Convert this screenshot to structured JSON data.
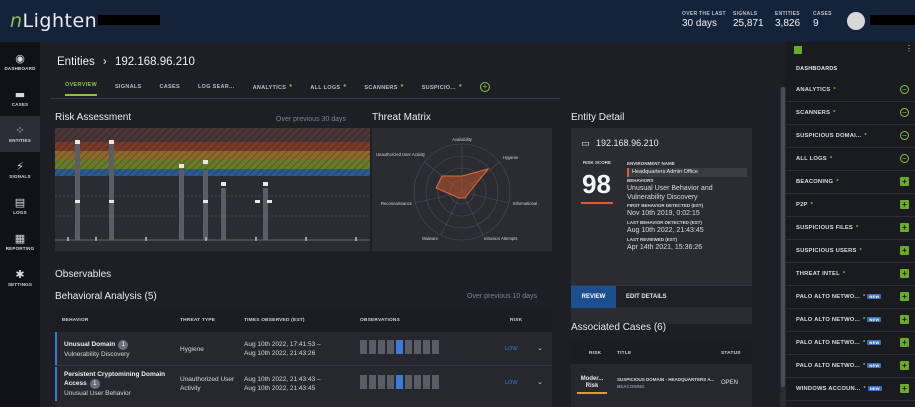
{
  "topbar": {
    "logo_prefix": "n",
    "logo_main": "Lighten",
    "stats": [
      {
        "label": "OVER THE LAST",
        "value": "30 days"
      },
      {
        "label": "SIGNALS",
        "value": "25,871"
      },
      {
        "label": "ENTITIES",
        "value": "3,826"
      },
      {
        "label": "CASES",
        "value": "9"
      }
    ]
  },
  "leftnav": [
    {
      "icon": "dashboard-icon",
      "glyph": "◉",
      "label": "DASHBOARD"
    },
    {
      "icon": "cases-icon",
      "glyph": "▬",
      "label": "CASES"
    },
    {
      "icon": "entities-icon",
      "glyph": "⁘",
      "label": "ENTITIES"
    },
    {
      "icon": "signals-icon",
      "glyph": "⚡",
      "label": "SIGNALS"
    },
    {
      "icon": "logs-icon",
      "glyph": "▤",
      "label": "LOGS"
    },
    {
      "icon": "reporting-icon",
      "glyph": "▦",
      "label": "REPORTING"
    },
    {
      "icon": "settings-icon",
      "glyph": "✱",
      "label": "SETTINGS"
    }
  ],
  "breadcrumb": {
    "parent": "Entities",
    "separator": "›",
    "current": "192.168.96.210"
  },
  "tabs": [
    "OVERVIEW",
    "SIGNALS",
    "CASES",
    "LOG SEAR...",
    "ANALYTICS",
    "ALL LOGS",
    "SCANNERS",
    "SUSPICIO..."
  ],
  "risk": {
    "title": "Risk Assessment",
    "subtitle": "Over previous 30 days"
  },
  "threat": {
    "title": "Threat Matrix",
    "axes": [
      "Availability",
      "Hygiene",
      "Informational",
      "Intrusion Attempts",
      "Malware",
      "Reconnaissance",
      "Unauthorized User Activity"
    ]
  },
  "observables": {
    "title": "Observables"
  },
  "behavioral": {
    "title": "Behavioral Analysis (5)",
    "subtitle": "Over previous 10 days",
    "columns": [
      "BEHAVIOR",
      "THREAT TYPE",
      "TIMES OBSERVED (EST)",
      "OBSERVATIONS",
      "RISK"
    ],
    "rows": [
      {
        "name": "Unusual Domain",
        "count": "1",
        "sub": "Vulnerability Discovery",
        "type": "Hygiene",
        "t1": "Aug 10th 2022, 17:41:53 –",
        "t2": "Aug 10th 2022, 21:43:26",
        "risk": "LOW"
      },
      {
        "name": "Persistent Cryptomining Domain Access",
        "count": "1",
        "sub": "Unusual User Behavior",
        "type": "Unauthorized User Activity",
        "t1": "Aug 10th 2022, 21:43:43 –",
        "t2": "Aug 10th 2022, 21:43:45",
        "risk": "LOW"
      }
    ]
  },
  "entity": {
    "title": "Entity Detail",
    "ip": "192.168.96.210",
    "risk_label": "RISK SCORE",
    "risk_score": "98",
    "env_label": "ENVIRONMENT NAME",
    "env_value": "Headquarters Admin Office",
    "behaviors_label": "BEHAVIORS",
    "behaviors_value": "Unusual User Behavior and Vulnerability Discovery",
    "first_label": "FIRST BEHAVIOR DETECTED (EST)",
    "first_value": "Nov 10th 2019, 0:02:15",
    "last_label": "LAST BEHAVIOR DETECTED (EST)",
    "last_value": "Aug 10th 2022, 21:43:45",
    "reviewed_label": "LAST REVIEWED (EST)",
    "reviewed_value": "Apr 14th 2021, 15:36:26",
    "review_btn": "REVIEW",
    "edit_btn": "EDIT DETAILS"
  },
  "assoc": {
    "title": "Associated Cases (6)",
    "columns": [
      "RISK",
      "TITLE",
      "STATUS"
    ],
    "rows": [
      {
        "risk": "Moder... Risk",
        "title": "SUSPICIOUS DOMAIN - HEADQUARTERS A...",
        "sub": "BEACONING",
        "status": "OPEN"
      }
    ]
  },
  "rightpanel": {
    "head": "DASHBOARDS",
    "items": [
      {
        "label": "ANALYTICS",
        "dot": "*",
        "tag": "",
        "ctrl": "minus"
      },
      {
        "label": "SCANNERS",
        "dot": "*",
        "tag": "",
        "ctrl": "minus"
      },
      {
        "label": "SUSPICIOUS DOMAI...",
        "dot": "*",
        "tag": "",
        "ctrl": "minus"
      },
      {
        "label": "ALL LOGS",
        "dot": "*",
        "tag": "",
        "ctrl": "minus"
      },
      {
        "label": "BEACONING",
        "dot": "*",
        "tag": "",
        "ctrl": "plus"
      },
      {
        "label": "P2P",
        "dot": "*",
        "tag": "",
        "ctrl": "plus"
      },
      {
        "label": "SUSPICIOUS FILES",
        "dot": "*",
        "tag": "",
        "ctrl": "plus"
      },
      {
        "label": "SUSPICIOUS USERS",
        "dot": "*",
        "tag": "",
        "ctrl": "plus"
      },
      {
        "label": "THREAT INTEL",
        "dot": "*",
        "tag": "",
        "ctrl": "plus"
      },
      {
        "label": "PALO ALTO NETWO...",
        "dot": "*",
        "tag": "NEW",
        "ctrl": "plus"
      },
      {
        "label": "PALO ALTO NETWO...",
        "dot": "*",
        "tag": "NEW",
        "ctrl": "plus"
      },
      {
        "label": "PALO ALTO NETWO...",
        "dot": "*",
        "tag": "NEW",
        "ctrl": "plus"
      },
      {
        "label": "PALO ALTO NETWO...",
        "dot": "*",
        "tag": "NEW",
        "ctrl": "plus"
      },
      {
        "label": "WINDOWS ACCOUN...",
        "dot": "*",
        "tag": "NEW",
        "ctrl": "plus"
      }
    ]
  },
  "colors": {
    "accent": "#8bc34a",
    "link": "#3a7bd5",
    "risk_underline": "#e05a2b"
  }
}
